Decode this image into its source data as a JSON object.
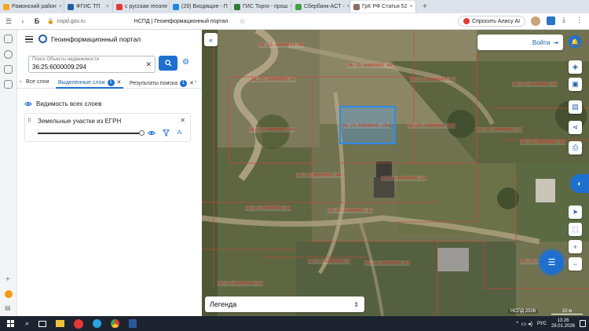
{
  "browser": {
    "tabs": [
      {
        "label": "Рамонский район",
        "color": "#f5a623"
      },
      {
        "label": "ФГИС ТП",
        "color": "#1f5fa8"
      },
      {
        "label": "с русская геоэле",
        "color": "#e53935"
      },
      {
        "label": "(29) Входящие - П",
        "color": "#1e88e5"
      },
      {
        "label": "ГИС Торги - прош",
        "color": "#2e7d32"
      },
      {
        "label": "Сбербанк-АСТ -",
        "color": "#43a047"
      },
      {
        "label": "ГрК РФ Статья 52",
        "color": "#8d6e63"
      }
    ],
    "url": "nspd.gov.ru",
    "page_title": "НСПД | Геоинформационный портал",
    "alice_label": "Спросить Алису AI"
  },
  "panel": {
    "title": "Геоинформационный портал",
    "search_label": "Поиск Объекты недвижимости",
    "search_value": "36:25:6000009:294",
    "tabs": [
      {
        "label": "Все слои",
        "badge": ""
      },
      {
        "label": "Выделенные слои",
        "badge": "1"
      },
      {
        "label": "Результаты поиска",
        "badge": "1"
      }
    ],
    "visibility_label": "Видимость всех слоев",
    "layer_name": "Земельные участки из ЕГРН"
  },
  "map": {
    "login_label": "Войти",
    "legend_label": "Легенда",
    "attribution": "НСПД 2026",
    "scale_label": "10 м",
    "parcel_labels": [
      "36:25:6000009:50",
      "36:25:6000009:49",
      "36:25:6000009:47",
      "36:25:6000009:48",
      "36:25:6000009:52",
      "36:25:6000009:44",
      "36:25:6000009:294",
      "36:25:6000009:295",
      "36:25:6000009:13",
      "36:25:6000009:14",
      "36:25:6000009:19",
      "36:25:6000009:18",
      "36:25:6000009:56",
      "36:25:6000009:12",
      "36:25:6000009:63",
      "36:25:6000009:5",
      "36:25:6000009:20",
      "36:25:6000009:33"
    ]
  },
  "taskbar": {
    "time": "13:26",
    "date": "29.01.2026",
    "lang": "РУС"
  }
}
